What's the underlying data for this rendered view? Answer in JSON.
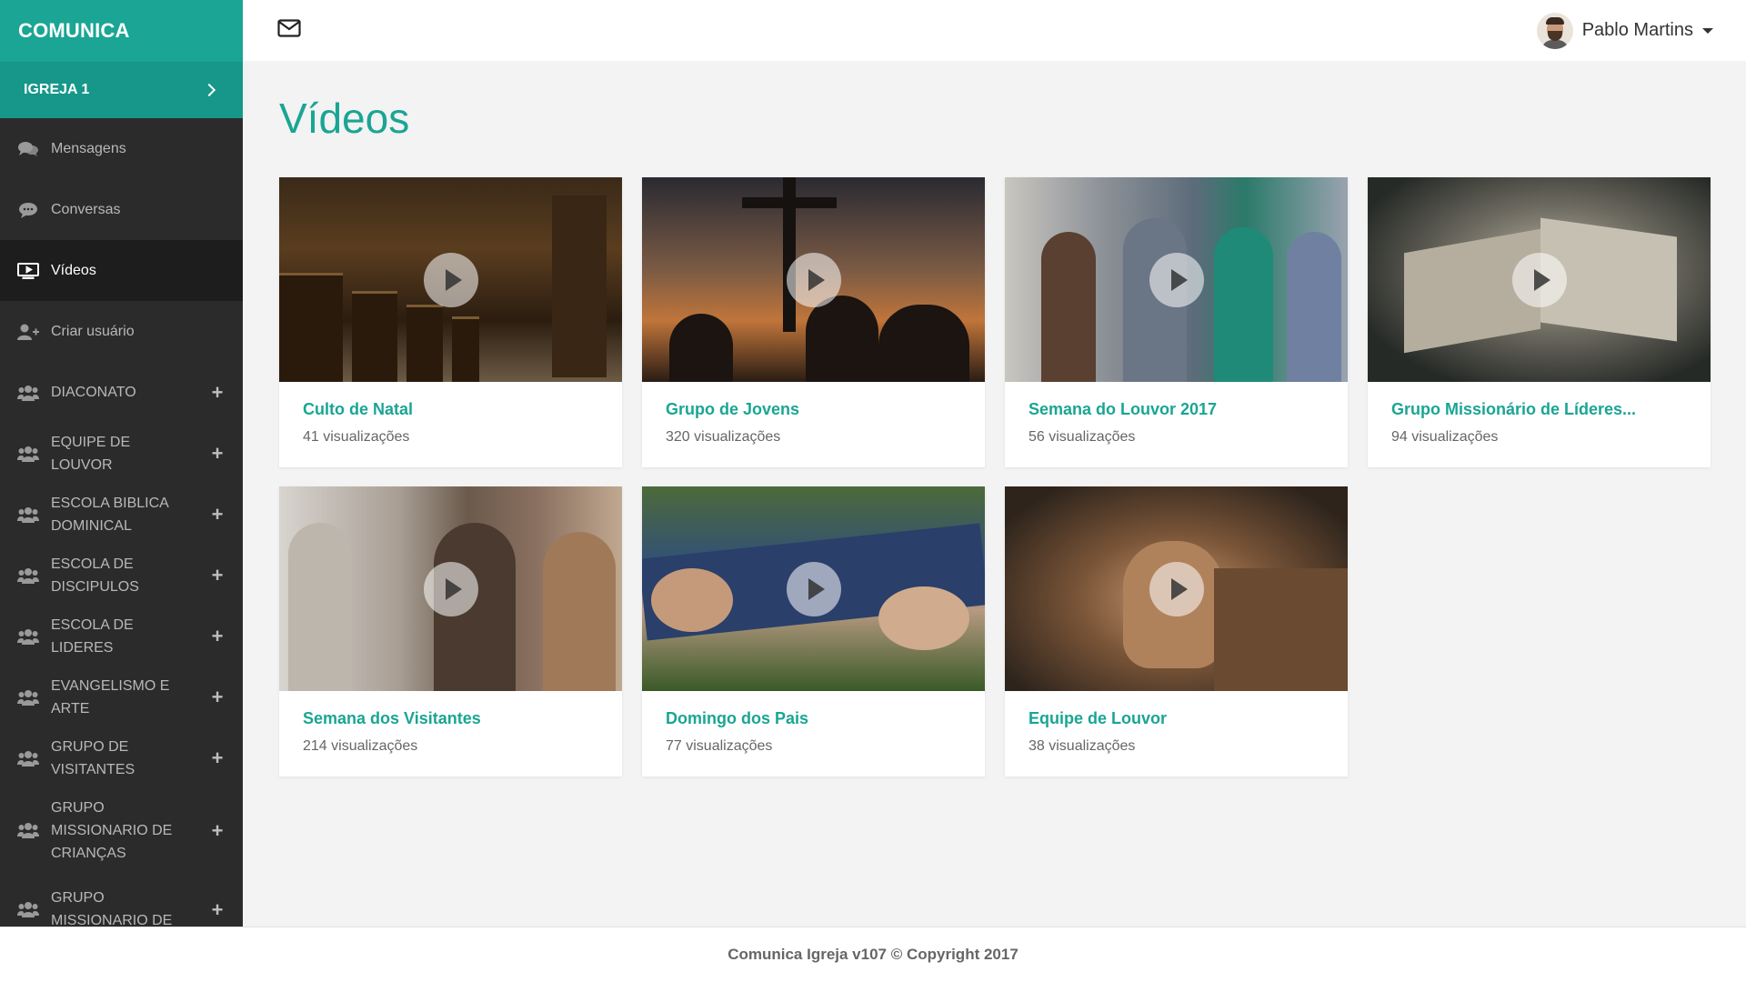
{
  "app": {
    "brand": "COMUNICA",
    "church": "IGREJA 1"
  },
  "sidebar": {
    "nav": [
      {
        "label": "Mensagens",
        "icon": "chat-icon"
      },
      {
        "label": "Conversas",
        "icon": "comment-icon"
      },
      {
        "label": "Vídeos",
        "icon": "video-icon"
      },
      {
        "label": "Criar usuário",
        "icon": "add-user-icon"
      }
    ],
    "groups": [
      {
        "lines": [
          "DIACONATO"
        ]
      },
      {
        "lines": [
          "EQUIPE DE",
          "LOUVOR"
        ]
      },
      {
        "lines": [
          "ESCOLA BIBLICA",
          "DOMINICAL"
        ]
      },
      {
        "lines": [
          "ESCOLA DE",
          "DISCIPULOS"
        ]
      },
      {
        "lines": [
          "ESCOLA DE",
          "LIDERES"
        ]
      },
      {
        "lines": [
          "EVANGELISMO E",
          "ARTE"
        ]
      },
      {
        "lines": [
          "GRUPO DE",
          "VISITANTES"
        ]
      },
      {
        "lines": [
          "GRUPO",
          "MISSIONARIO DE",
          "CRIANÇAS"
        ]
      },
      {
        "lines": [
          "GRUPO",
          "MISSIONARIO DE"
        ]
      }
    ],
    "plus": "+"
  },
  "header": {
    "user_name": "Pablo Martins"
  },
  "main": {
    "title": "Vídeos",
    "videos": [
      {
        "title": "Culto de Natal",
        "views": "41 visualizações"
      },
      {
        "title": "Grupo de Jovens",
        "views": "320 visualizações"
      },
      {
        "title": "Semana do Louvor 2017",
        "views": "56 visualizações"
      },
      {
        "title": "Grupo Missionário de Líderes...",
        "views": "94 visualizações"
      },
      {
        "title": "Semana dos Visitantes",
        "views": "214 visualizações"
      },
      {
        "title": "Domingo dos Pais",
        "views": "77 visualizações"
      },
      {
        "title": "Equipe de Louvor",
        "views": "38 visualizações"
      }
    ]
  },
  "footer": {
    "text": "Comunica Igreja v107 © Copyright 2017"
  },
  "colors": {
    "accent": "#1aa594",
    "sidebar_bg": "#2b2b2b",
    "active_bg": "#1d1d1d"
  }
}
